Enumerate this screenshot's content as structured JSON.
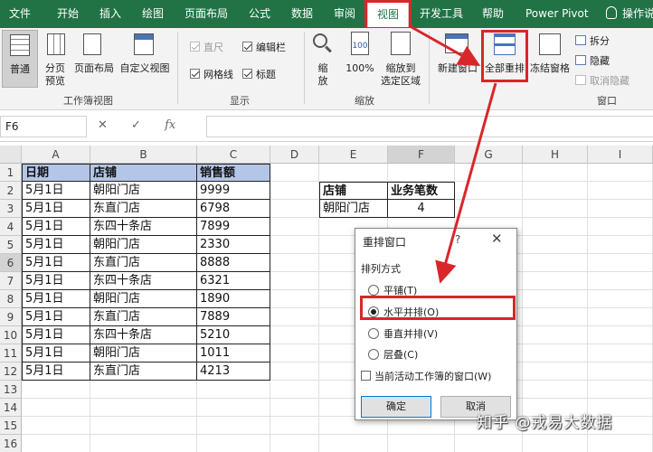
{
  "menu": {
    "tabs": [
      "文件",
      "开始",
      "插入",
      "绘图",
      "页面布局",
      "公式",
      "数据",
      "审阅",
      "视图",
      "开发工具",
      "帮助",
      "Power Pivot",
      "操作说"
    ],
    "active_index": 8
  },
  "ribbon": {
    "workbook_views": {
      "normal": "普通",
      "page_break_1": "分页",
      "page_break_2": "预览",
      "page_layout": "页面布局",
      "custom_views": "自定义视图",
      "group_label": "工作簿视图"
    },
    "show": {
      "ruler": "直尺",
      "formula_bar": "编辑栏",
      "gridlines": "网格线",
      "headings": "标题",
      "group_label": "显示"
    },
    "zoom": {
      "zoom_1": "缩",
      "zoom_2": "放",
      "zoom_100": "100%",
      "zoom_sel_1": "缩放到",
      "zoom_sel_2": "选定区域",
      "group_label": "缩放"
    },
    "window": {
      "new_window": "新建窗口",
      "arrange_all": "全部重排",
      "freeze_panes": "冻结窗格",
      "split": "拆分",
      "hide": "隐藏",
      "unhide": "取消隐藏",
      "group_label": "窗口"
    }
  },
  "formula_bar": {
    "name_box": "F6",
    "cancel_icon": "✕",
    "enter_icon": "✓",
    "fx": "fx"
  },
  "columns": [
    "A",
    "B",
    "C",
    "D",
    "E",
    "F",
    "G",
    "H",
    "I"
  ],
  "rows": [
    "1",
    "2",
    "3",
    "4",
    "5",
    "6",
    "7",
    "8",
    "9",
    "10",
    "11",
    "12",
    "13",
    "14",
    "15",
    "16"
  ],
  "table": {
    "headers": [
      "日期",
      "店铺",
      "销售额"
    ],
    "rows": [
      [
        "5月1日",
        "朝阳门店",
        "9999"
      ],
      [
        "5月1日",
        "东直门店",
        "6798"
      ],
      [
        "5月1日",
        "东四十条店",
        "7899"
      ],
      [
        "5月1日",
        "朝阳门店",
        "2330"
      ],
      [
        "5月1日",
        "东直门店",
        "8888"
      ],
      [
        "5月1日",
        "东四十条店",
        "6321"
      ],
      [
        "5月1日",
        "朝阳门店",
        "1890"
      ],
      [
        "5月1日",
        "东直门店",
        "7889"
      ],
      [
        "5月1日",
        "东四十条店",
        "5210"
      ],
      [
        "5月1日",
        "朝阳门店",
        "1011"
      ],
      [
        "5月1日",
        "东直门店",
        "4213"
      ]
    ]
  },
  "summary": {
    "headers": [
      "店铺",
      "业务笔数"
    ],
    "row": [
      "朝阳门店",
      "4"
    ]
  },
  "dialog": {
    "title": "重排窗口",
    "help": "?",
    "close": "✕",
    "group_label": "排列方式",
    "options": [
      "平铺(T)",
      "水平并排(O)",
      "垂直并排(V)",
      "层叠(C)"
    ],
    "selected_index": 1,
    "active_only": "当前活动工作簿的窗口(W)",
    "ok": "确定",
    "cancel": "取消"
  },
  "watermark": "知乎 @戎易大数据",
  "colors": {
    "ribbon_green": "#217346",
    "header_fill": "#b4c6e7",
    "highlight_red": "#d9262a"
  }
}
